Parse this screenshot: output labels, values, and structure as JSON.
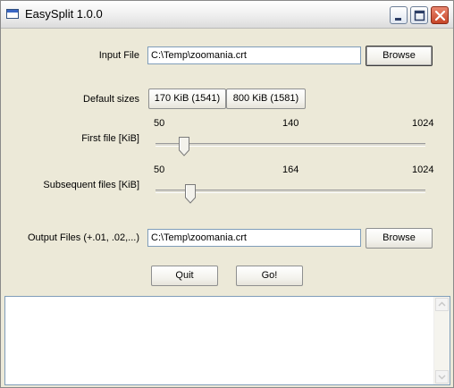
{
  "window": {
    "title": "EasySplit 1.0.0"
  },
  "input_file": {
    "label": "Input File",
    "value": "C:\\Temp\\zoomania.crt",
    "browse_label": "Browse"
  },
  "default_sizes": {
    "label": "Default sizes",
    "option1": "170 KiB (1541)",
    "option2": "800 KiB (1581)"
  },
  "first_file": {
    "label": "First file [KiB]",
    "min": "50",
    "current": "140",
    "max": "1024"
  },
  "subsequent_files": {
    "label": "Subsequent files [KiB]",
    "min": "50",
    "current": "164",
    "max": "1024"
  },
  "output_files": {
    "label": "Output Files (+.01, .02,...)",
    "value": "C:\\Temp\\zoomania.crt",
    "browse_label": "Browse"
  },
  "actions": {
    "quit_label": "Quit",
    "go_label": "Go!"
  },
  "log": {
    "text": ""
  }
}
